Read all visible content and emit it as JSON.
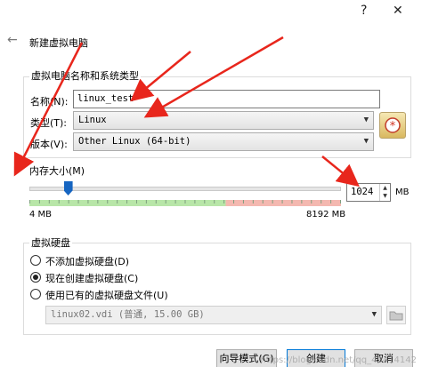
{
  "window": {
    "help_glyph": "?",
    "close_glyph": "✕"
  },
  "header": {
    "back_glyph": "←",
    "title": "新建虚拟电脑"
  },
  "name_os": {
    "group_label": "虚拟电脑名称和系统类型",
    "name_label": "名称(N):",
    "name_value": "linux_test",
    "type_label": "类型(T):",
    "type_value": "Linux",
    "version_label": "版本(V):",
    "version_value": "Other Linux (64-bit)",
    "combo_arrow": "▼"
  },
  "memory": {
    "label": "内存大小(M)",
    "value": "1024",
    "unit": "MB",
    "min_label": "4 MB",
    "max_label": "8192 MB",
    "min_mb": 4,
    "max_mb": 8192,
    "current_mb": 1024,
    "spin_up": "▲",
    "spin_down": "▼"
  },
  "disk": {
    "group_label": "虚拟硬盘",
    "options": [
      {
        "label": "不添加虚拟硬盘(D)",
        "selected": false
      },
      {
        "label": "现在创建虚拟硬盘(C)",
        "selected": true
      },
      {
        "label": "使用已有的虚拟硬盘文件(U)",
        "selected": false
      }
    ],
    "existing_file": "linux02.vdi (普通, 15.00 GB)"
  },
  "footer": {
    "expert_button": "向导模式(G)",
    "create_button": "创建",
    "cancel_button": "取消"
  },
  "watermark": "https://blog.csdn.net/qq_43414142",
  "colors": {
    "accent": "#1665c1",
    "annotation_red": "#e8261c"
  }
}
